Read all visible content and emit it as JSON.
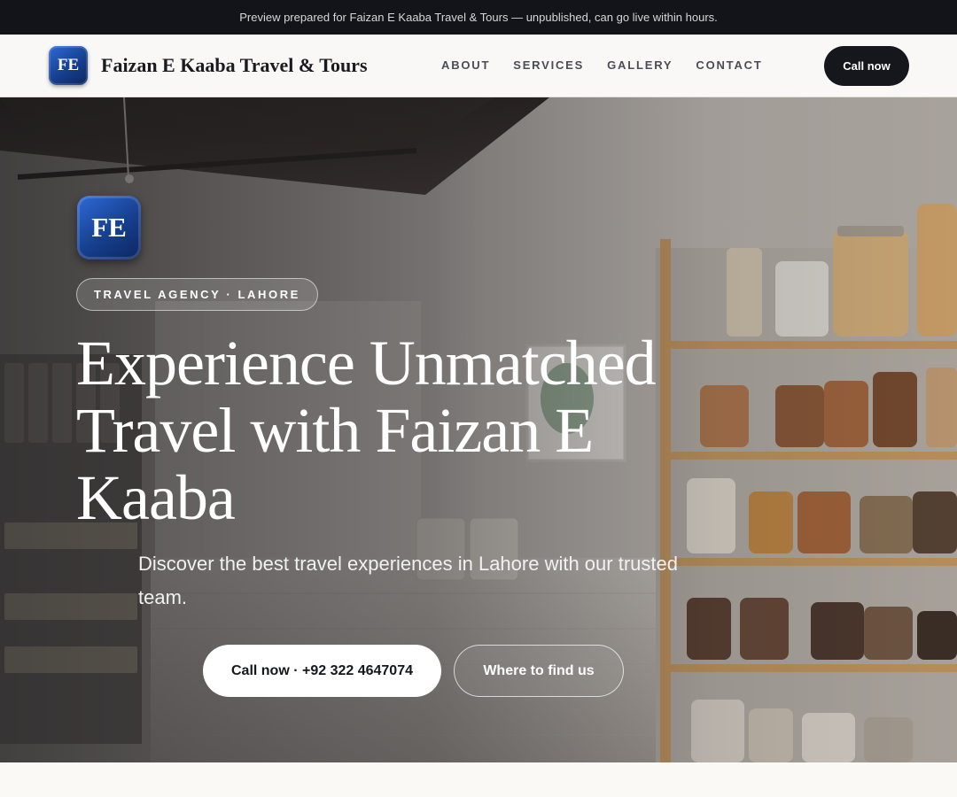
{
  "preview_banner": "Preview prepared for Faizan E Kaaba Travel & Tours — unpublished, can go live within hours.",
  "brand": {
    "logo_initials": "FE",
    "name": "Faizan E Kaaba Travel & Tours",
    "logo_colors": [
      "#2f6ad8",
      "#163f8e",
      "#0c2760"
    ]
  },
  "nav": {
    "links": [
      {
        "label": "ABOUT"
      },
      {
        "label": "SERVICES"
      },
      {
        "label": "GALLERY"
      },
      {
        "label": "CONTACT"
      }
    ],
    "cta_label": "Call now"
  },
  "hero": {
    "logo_initials": "FE",
    "tagline": "TRAVEL AGENCY · LAHORE",
    "headline": "Experience Unmatched Travel with Faizan E Kaaba",
    "subtext": "Discover the best travel experiences in Lahore with our trusted team.",
    "primary_button": "Call now · +92 322 4647074",
    "secondary_button": "Where to find us"
  },
  "colors": {
    "topbar_bg": "#121419",
    "nav_cta_bg": "#15171c",
    "page_bg": "#f7f6f3"
  }
}
